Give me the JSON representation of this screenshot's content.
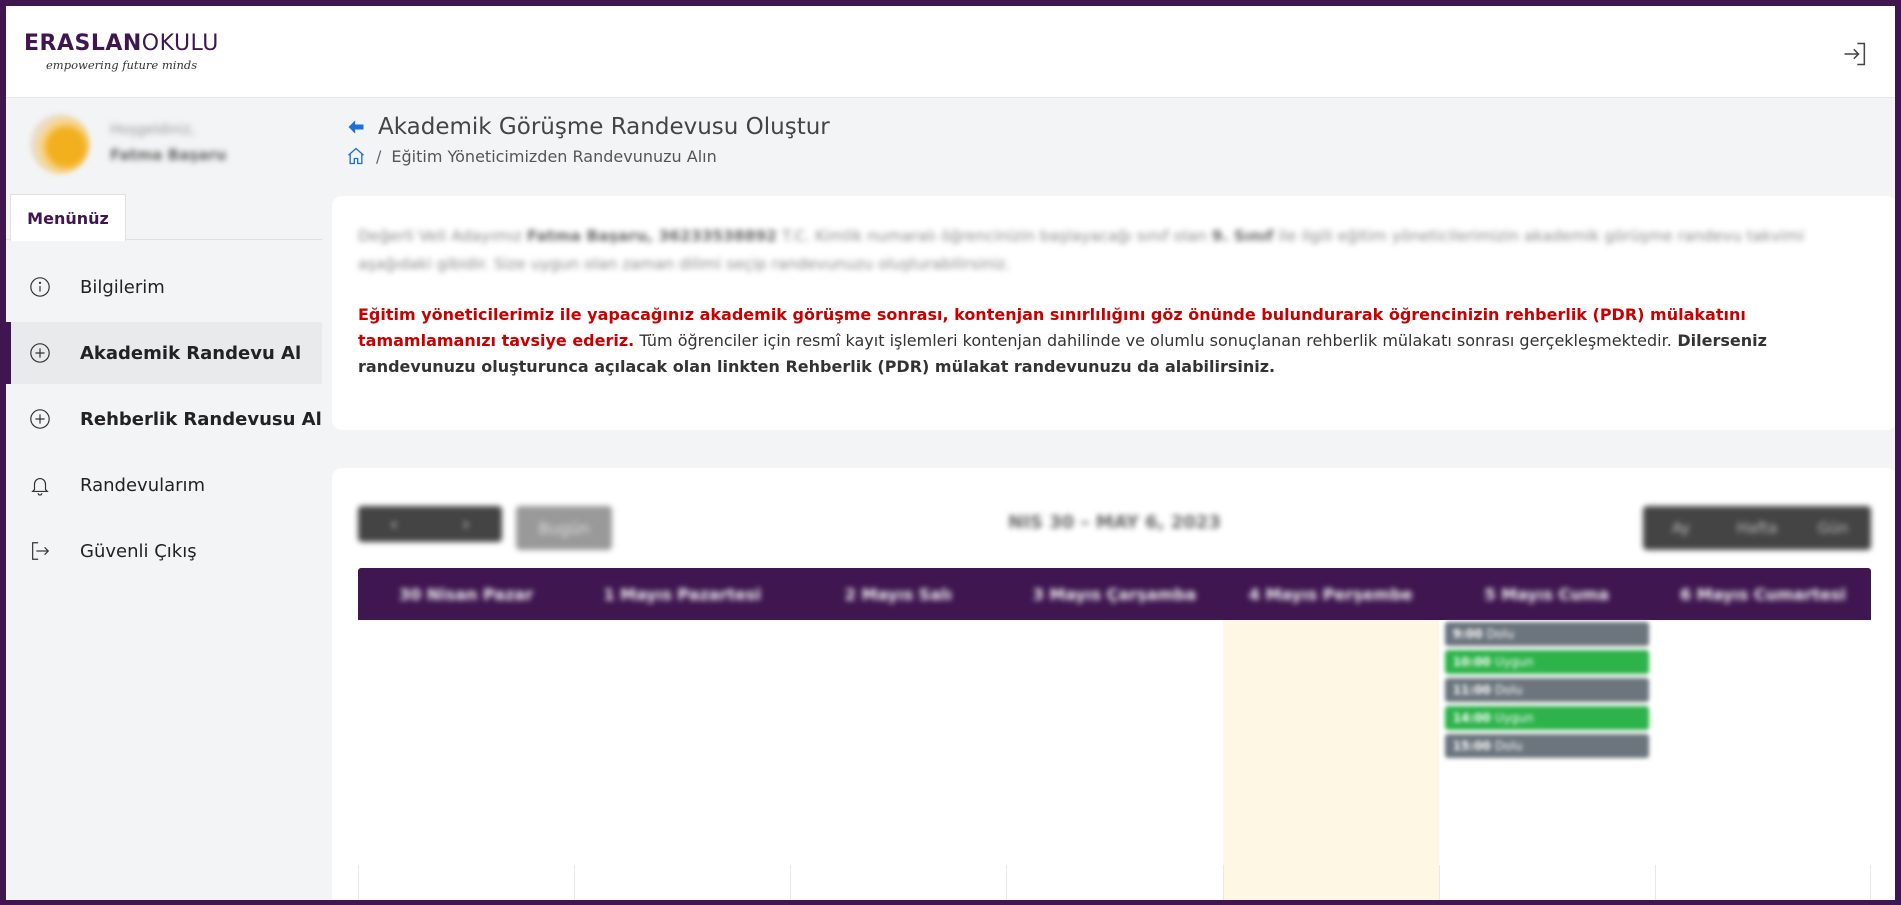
{
  "header": {
    "logo_bold": "ERASLAN",
    "logo_light": "OKULU",
    "logo_tagline": "empowering future minds"
  },
  "user": {
    "greeting": "Hoşgeldiniz,",
    "name": "Fatma Başaru"
  },
  "sidebar": {
    "tab_label": "Menünüz",
    "items": [
      {
        "label": "Bilgilerim",
        "icon": "info-circle-icon",
        "active": false,
        "bold": false
      },
      {
        "label": "Akademik Randevu Al",
        "icon": "plus-circle-icon",
        "active": true,
        "bold": true
      },
      {
        "label": "Rehberlik Randevusu Al",
        "icon": "plus-circle-icon",
        "active": false,
        "bold": true
      },
      {
        "label": "Randevularım",
        "icon": "bell-icon",
        "active": false,
        "bold": false
      },
      {
        "label": "Güvenli Çıkış",
        "icon": "logout-icon",
        "active": false,
        "bold": false
      }
    ]
  },
  "page": {
    "title": "Akademik Görüşme Randevusu Oluştur",
    "breadcrumb": "Eğitim Yöneticimizden Randevunuzu Alın"
  },
  "info": {
    "blur_part1": "Değerli Veli Adayımız ",
    "blur_name": "Fatma Başaru, 36233538892",
    "blur_part2": " T.C. Kimlik numaralı öğrencinizin başlayacağı sınıf olan ",
    "blur_grade": "9. Sınıf",
    "blur_part3": " ile ilgili eğitim yöneticilerimizin akademik görüşme randevu takvimi aşağıdaki gibidir. Size uygun olan zaman dilimi seçip randevunuzu oluşturabilirsiniz.",
    "notice_red": "Eğitim yöneticilerimiz ile yapacağınız akademik görüşme sonrası, kontenjan sınırlılığını göz önünde bulundurarak öğrencinizin rehberlik (PDR) mülakatını tamamlamanızı tavsiye ederiz.",
    "notice_normal": " Tüm öğrenciler için resmî kayıt işlemleri kontenjan dahilinde ve olumlu sonuçlanan rehberlik mülakatı sonrası gerçekleşmektedir.",
    "notice_bold": " Dilerseniz randevunuzu oluşturunca açılacak olan linkten Rehberlik (PDR) mülakat randevunuzu da alabilirsiniz."
  },
  "calendar": {
    "prev": "‹",
    "next": "›",
    "today_label": "Bugün",
    "range": "NIS 30 – MAY 6, 2023",
    "views": [
      "Ay",
      "Hafta",
      "Gün"
    ],
    "days": [
      "30 Nisan Pazar",
      "1 Mayıs Pazartesi",
      "2 Mayıs Salı",
      "3 Mayıs Çarşamba",
      "4 Mayıs Perşembe",
      "5 Mayıs Cuma",
      "6 Mayıs Cumartesi"
    ],
    "today_index": 4,
    "events_day_index": 5,
    "events": [
      {
        "time": "9:00",
        "label": "Dolu",
        "status": "gray"
      },
      {
        "time": "10:00",
        "label": "Uygun",
        "status": "green"
      },
      {
        "time": "11:00",
        "label": "Dolu",
        "status": "gray"
      },
      {
        "time": "14:00",
        "label": "Uygun",
        "status": "green"
      },
      {
        "time": "15:00",
        "label": "Dolu",
        "status": "gray"
      }
    ],
    "colors": {
      "header": "#3f1650",
      "available": "#2db34a",
      "booked": "#6c757d",
      "today": "#fdf7e4"
    }
  }
}
